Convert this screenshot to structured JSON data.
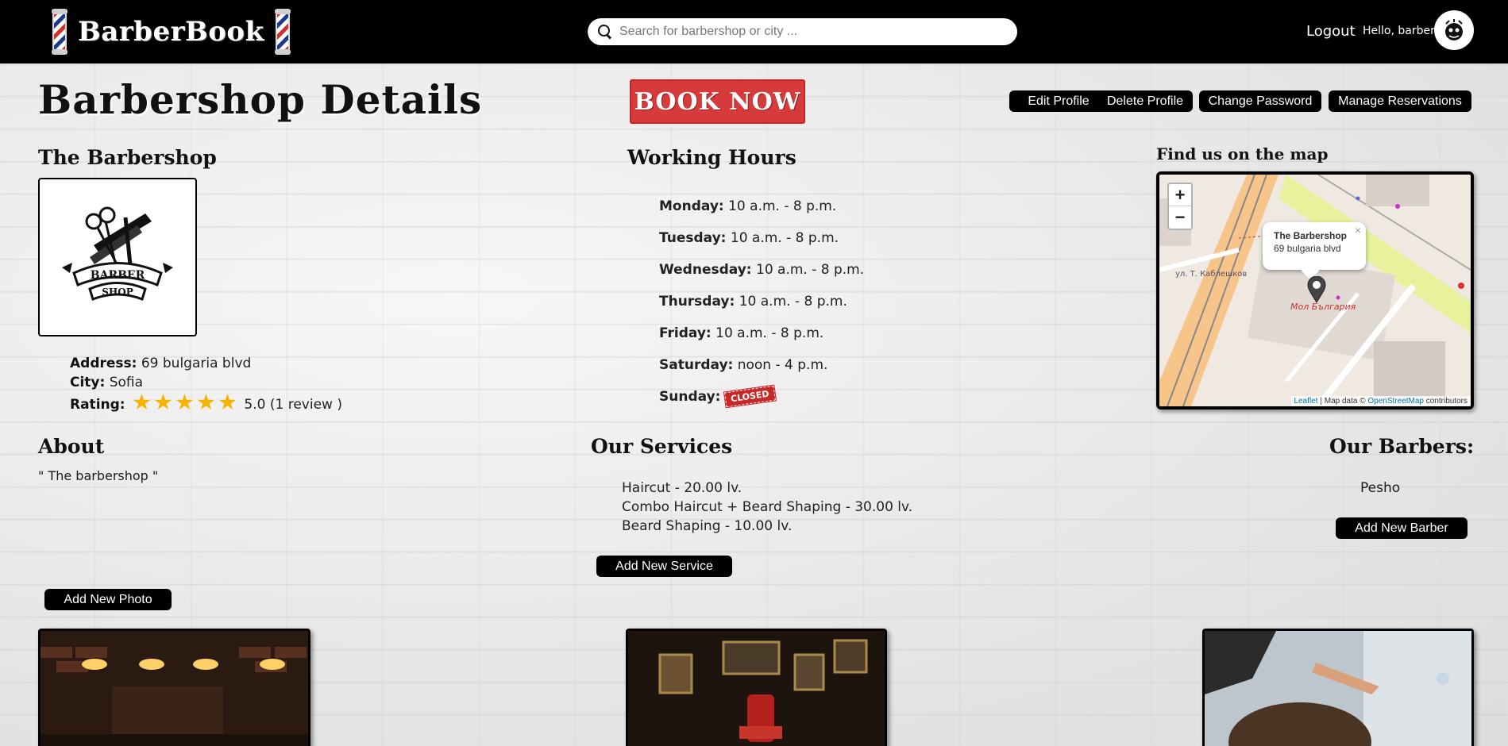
{
  "header": {
    "brand": "BarberBook",
    "search_placeholder": "Search for barbershop or city ...",
    "logout": "Logout",
    "greeting": "Hello, barber"
  },
  "page": {
    "title": "Barbershop Details",
    "book_now": "BOOK NOW",
    "actions": {
      "edit_profile": "Edit Profile",
      "delete_profile": "Delete Profile",
      "change_password": "Change Password",
      "manage_reservations": "Manage Reservations"
    }
  },
  "shop": {
    "heading": "The Barbershop",
    "logo_text": [
      "BARBER",
      "SHOP"
    ],
    "address_label": "Address:",
    "address": "69 bulgaria blvd",
    "city_label": "City:",
    "city": "Sofia",
    "rating_label": "Rating:",
    "rating_stars": 5,
    "rating_value": "5.0",
    "rating_count": "(1 review )"
  },
  "hours": {
    "heading": "Working Hours",
    "days": [
      {
        "day": "Monday:",
        "time": "10 a.m. - 8 p.m."
      },
      {
        "day": "Tuesday:",
        "time": "10 a.m. - 8 p.m."
      },
      {
        "day": "Wednesday:",
        "time": "10 a.m. - 8 p.m."
      },
      {
        "day": "Thursday:",
        "time": "10 a.m. - 8 p.m."
      },
      {
        "day": "Friday:",
        "time": "10 a.m. - 8 p.m."
      },
      {
        "day": "Saturday:",
        "time": "noon - 4 p.m."
      },
      {
        "day": "Sunday:",
        "time": ""
      }
    ],
    "closed_badge": "CLOSED"
  },
  "map": {
    "heading": "Find us on the map",
    "zoom_in": "+",
    "zoom_out": "−",
    "popup_title": "The Barbershop",
    "popup_address": "69 bulgaria blvd",
    "popup_close": "×",
    "place_label": "Мол България",
    "street_label": "ул. Т. Каблешков",
    "attribution_leaflet": "Leaflet",
    "attribution_mid": " | Map data © ",
    "attribution_osm": "OpenStreetMap",
    "attribution_end": " contributors"
  },
  "about": {
    "heading": "About",
    "text": "\" The barbershop \""
  },
  "services": {
    "heading": "Our Services",
    "items": [
      "Haircut - 20.00 lv.",
      "Combo Haircut + Beard Shaping - 30.00 lv.",
      "Beard Shaping - 10.00 lv."
    ],
    "add_button": "Add New Service"
  },
  "barbers": {
    "heading": "Our Barbers:",
    "items": [
      "Pesho"
    ],
    "add_button": "Add New Barber"
  },
  "photos": {
    "add_button": "Add New Photo"
  },
  "colors": {
    "header_bg": "#000000",
    "book_now_bg": "#d63a3a",
    "star": "#f5b301",
    "closed": "#c62828"
  }
}
